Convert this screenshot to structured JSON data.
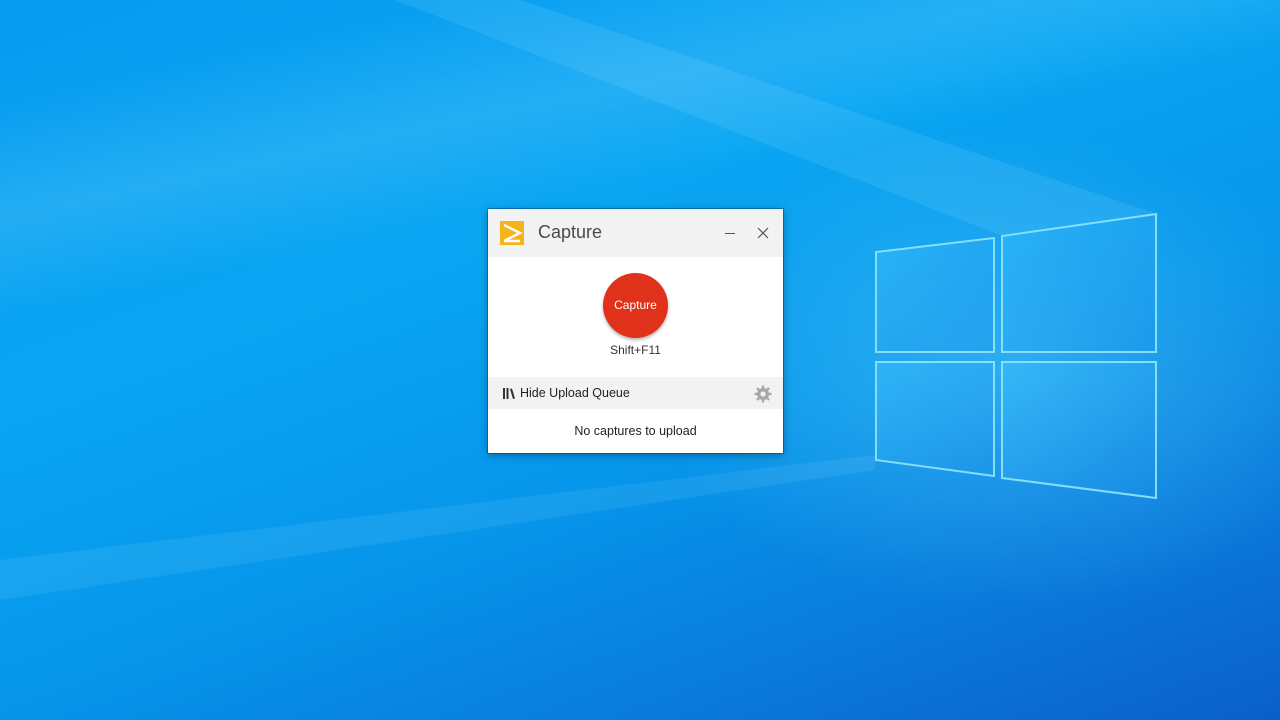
{
  "desktop": {
    "wallpaper_colors": {
      "base": "#079bf0",
      "dark": "#0a5fc9",
      "logo_glow": "#8fe6ff"
    }
  },
  "window": {
    "title": "Capture",
    "app_icon": "capture-app-icon",
    "controls": {
      "minimize_icon": "minimize-icon",
      "close_icon": "close-icon"
    },
    "capture_button": {
      "label": "Capture",
      "color": "#e0321a"
    },
    "shortcut": "Shift+F11",
    "upload_queue": {
      "toggle_label": "Hide Upload Queue",
      "toggle_icon": "books-icon",
      "settings_icon": "gear-icon",
      "empty_message": "No captures to upload"
    }
  }
}
